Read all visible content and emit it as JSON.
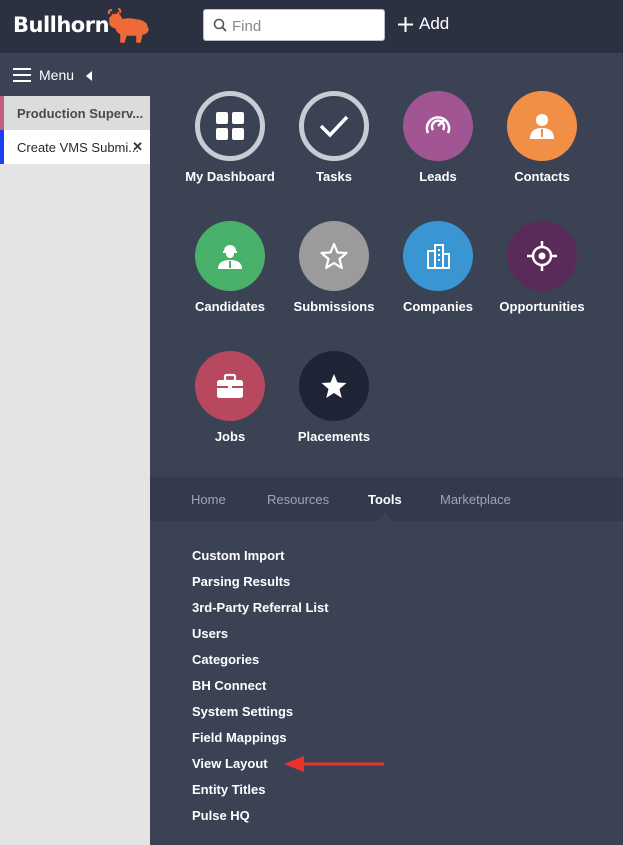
{
  "brand": {
    "name": "Bullhorn",
    "accent": "#ef6a37"
  },
  "search": {
    "placeholder": "Find",
    "value": ""
  },
  "add": {
    "label": "Add"
  },
  "menu": {
    "label": "Menu"
  },
  "open_tabs": [
    {
      "label": "Production Superv...",
      "color": "#c0607a"
    },
    {
      "label": "Create VMS Submi...",
      "color": "#1b3ff0",
      "closable": true
    }
  ],
  "tiles": [
    {
      "label": "My Dashboard",
      "icon": "dashboard-grid-icon"
    },
    {
      "label": "Tasks",
      "icon": "checkmark-icon"
    },
    {
      "label": "Leads",
      "icon": "leads-icon",
      "color": "#a25593"
    },
    {
      "label": "Contacts",
      "icon": "contact-person-icon",
      "color": "#f28f47"
    },
    {
      "label": "Candidates",
      "icon": "candidate-person-icon",
      "color": "#4ab16a"
    },
    {
      "label": "Submissions",
      "icon": "star-outline-icon",
      "color": "#9b9b9b"
    },
    {
      "label": "Companies",
      "icon": "building-icon",
      "color": "#3996d3"
    },
    {
      "label": "Opportunities",
      "icon": "target-icon",
      "color": "#5a2a58"
    },
    {
      "label": "Jobs",
      "icon": "briefcase-icon",
      "color": "#b8485e"
    },
    {
      "label": "Placements",
      "icon": "star-solid-icon",
      "color": "#1e2435"
    }
  ],
  "nav_tabs": [
    "Home",
    "Resources",
    "Tools",
    "Marketplace"
  ],
  "active_nav_tab": "Tools",
  "tools": [
    "Custom Import",
    "Parsing Results",
    "3rd-Party Referral List",
    "Users",
    "Categories",
    "BH Connect",
    "System Settings",
    "Field Mappings",
    "View Layout",
    "Entity Titles",
    "Pulse HQ"
  ],
  "annotation_color": "#e8322c"
}
